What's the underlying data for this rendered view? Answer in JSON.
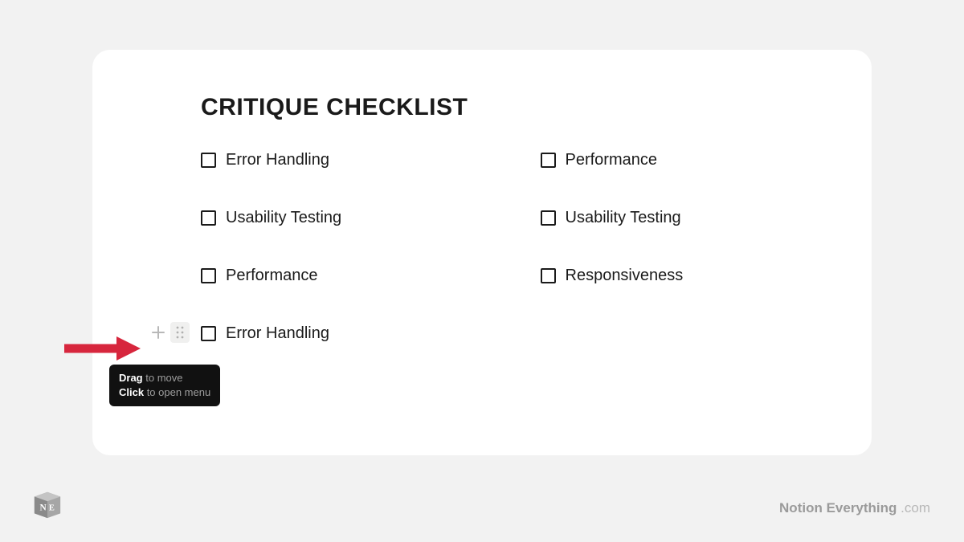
{
  "title": "CRITIQUE CHECKLIST",
  "left": [
    {
      "label": "Error Handling"
    },
    {
      "label": "Usability Testing"
    },
    {
      "label": "Performance"
    },
    {
      "label": "Error Handling"
    }
  ],
  "right": [
    {
      "label": "Performance"
    },
    {
      "label": "Usability Testing"
    },
    {
      "label": "Responsiveness"
    }
  ],
  "tooltip": {
    "drag_bold": "Drag",
    "drag_rest": " to move",
    "click_bold": "Click",
    "click_rest": " to open menu"
  },
  "footer": {
    "brand": "Notion Everything",
    "domain": " .com"
  }
}
